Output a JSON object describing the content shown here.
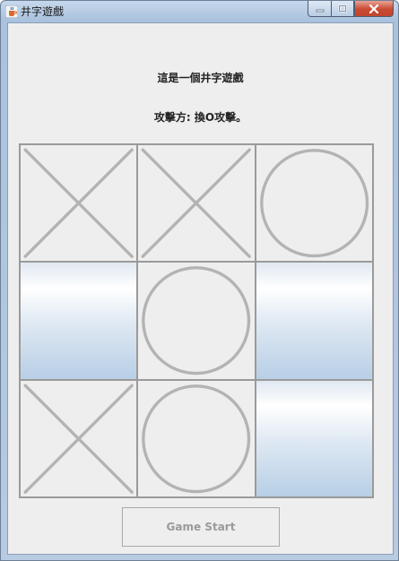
{
  "window": {
    "title": "井字遊戲",
    "icon": "java-cup-icon"
  },
  "main": {
    "heading": "這是一個井字遊戲",
    "status": "攻擊方: 換O攻擊。",
    "board": [
      [
        "X",
        "X",
        "O"
      ],
      [
        "",
        "O",
        ""
      ],
      [
        "X",
        "O",
        ""
      ]
    ],
    "mark_color": "#b3b3b3",
    "start_button_label": "Game Start"
  }
}
